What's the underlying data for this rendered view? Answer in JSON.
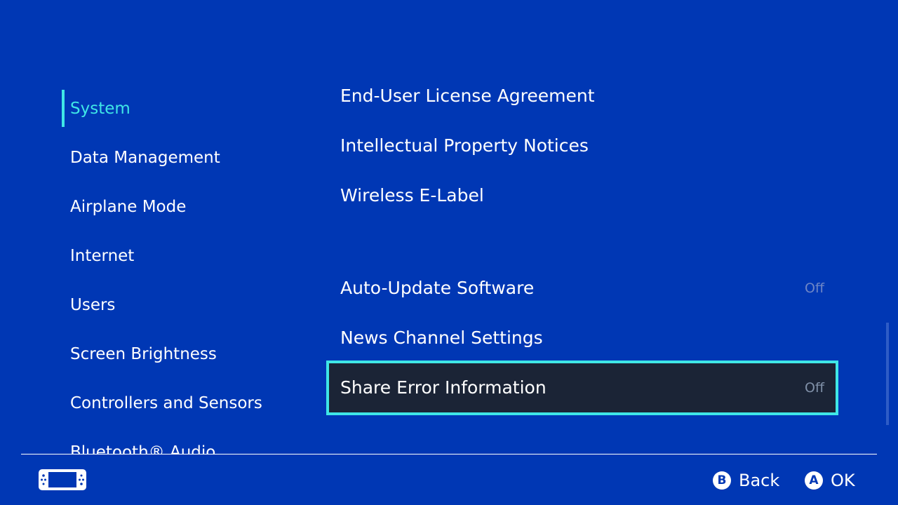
{
  "sidebar": {
    "items": [
      {
        "label": "System",
        "active": true
      },
      {
        "label": "Data Management"
      },
      {
        "label": "Airplane Mode"
      },
      {
        "label": "Internet"
      },
      {
        "label": "Users"
      },
      {
        "label": "Screen Brightness"
      },
      {
        "label": "Controllers and Sensors"
      },
      {
        "label": "Bluetooth® Audio"
      }
    ]
  },
  "panel": {
    "rows": [
      {
        "label": "End-User License Agreement"
      },
      {
        "label": "Intellectual Property Notices"
      },
      {
        "label": "Wireless E-Label"
      },
      {
        "label": "Auto-Update Software",
        "value": "Off"
      },
      {
        "label": "News Channel Settings"
      },
      {
        "label": "Share Error Information",
        "value": "Off",
        "selected": true
      }
    ]
  },
  "footer": {
    "back": {
      "button": "B",
      "label": "Back"
    },
    "ok": {
      "button": "A",
      "label": "OK"
    }
  },
  "colors": {
    "background": "#0037b4",
    "accent": "#3fe6e6",
    "selected_row": "#1b2436"
  }
}
